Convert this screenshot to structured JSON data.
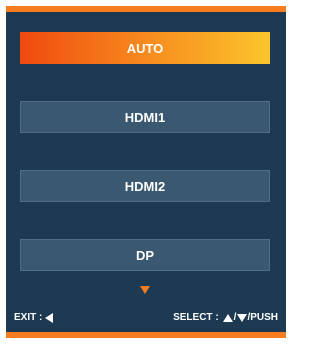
{
  "menu": {
    "items": [
      {
        "label": "AUTO",
        "selected": true
      },
      {
        "label": "HDMI1",
        "selected": false
      },
      {
        "label": "HDMI2",
        "selected": false
      },
      {
        "label": "DP",
        "selected": false
      }
    ],
    "scroll_indicator_icon": "triangle-down-icon"
  },
  "footer": {
    "exit_label": "EXIT :",
    "exit_icon": "triangle-left-icon",
    "select_label": "SELECT :",
    "up_icon": "triangle-up-icon",
    "separator": "/",
    "down_icon": "triangle-down-icon",
    "push_label": "/PUSH"
  },
  "colors": {
    "panel_background": "#1d3a52",
    "accent": "#f57c1f",
    "item_background": "#3a5970",
    "selected_gradient_start": "#f04a10",
    "selected_gradient_end": "#fbc52c",
    "text": "#ffffff"
  }
}
